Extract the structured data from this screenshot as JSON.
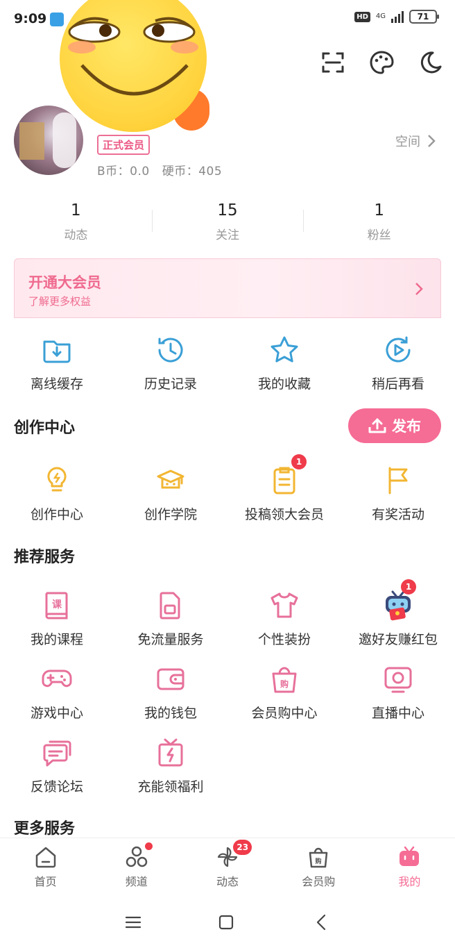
{
  "status_bar": {
    "time": "9:09",
    "hd": "HD",
    "network": "4G",
    "battery": "71"
  },
  "profile": {
    "vip_tag": "正式会员",
    "b_coin": "B币：0.0",
    "coin": "硬币：405",
    "space_link": "空间"
  },
  "stats": [
    {
      "value": "1",
      "label": "动态"
    },
    {
      "value": "15",
      "label": "关注"
    },
    {
      "value": "1",
      "label": "粉丝"
    }
  ],
  "vip_banner": {
    "title": "开通大会员",
    "subtitle": "了解更多权益"
  },
  "quick_actions": [
    {
      "label": "离线缓存",
      "icon": "download-folder-icon"
    },
    {
      "label": "历史记录",
      "icon": "history-clock-icon"
    },
    {
      "label": "我的收藏",
      "icon": "star-icon"
    },
    {
      "label": "稍后再看",
      "icon": "watch-later-icon"
    }
  ],
  "creation": {
    "title": "创作中心",
    "publish_label": "发布",
    "items": [
      {
        "label": "创作中心",
        "icon": "lightbulb-icon"
      },
      {
        "label": "创作学院",
        "icon": "academy-icon"
      },
      {
        "label": "投稿领大会员",
        "icon": "clipboard-icon",
        "badge": "1"
      },
      {
        "label": "有奖活动",
        "icon": "flag-icon"
      }
    ]
  },
  "recommended": {
    "title": "推荐服务",
    "items": [
      {
        "label": "我的课程",
        "icon": "course-book-icon"
      },
      {
        "label": "免流量服务",
        "icon": "sim-card-icon"
      },
      {
        "label": "个性装扮",
        "icon": "tshirt-icon"
      },
      {
        "label": "邀好友赚红包",
        "icon": "tv-mascot-icon",
        "badge": "1"
      },
      {
        "label": "游戏中心",
        "icon": "gamepad-icon"
      },
      {
        "label": "我的钱包",
        "icon": "wallet-icon"
      },
      {
        "label": "会员购中心",
        "icon": "shopping-bag-icon"
      },
      {
        "label": "直播中心",
        "icon": "live-tv-icon"
      },
      {
        "label": "反馈论坛",
        "icon": "chat-bubbles-icon"
      },
      {
        "label": "充能领福利",
        "icon": "gift-bolt-icon"
      }
    ]
  },
  "more_services": {
    "title": "更多服务"
  },
  "bottom_nav": [
    {
      "label": "首页",
      "icon": "home-icon"
    },
    {
      "label": "频道",
      "icon": "channel-icon",
      "dot": true
    },
    {
      "label": "动态",
      "icon": "pinwheel-icon",
      "badge": "23"
    },
    {
      "label": "会员购",
      "icon": "shopping-bag-icon"
    },
    {
      "label": "我的",
      "icon": "tv-icon",
      "active": true
    }
  ],
  "colors": {
    "accent": "#f56c95",
    "icon_blue": "#3a9fd6",
    "icon_yellow": "#f2b632",
    "icon_pink": "#e7709a",
    "badge_red": "#ef3b4a"
  }
}
